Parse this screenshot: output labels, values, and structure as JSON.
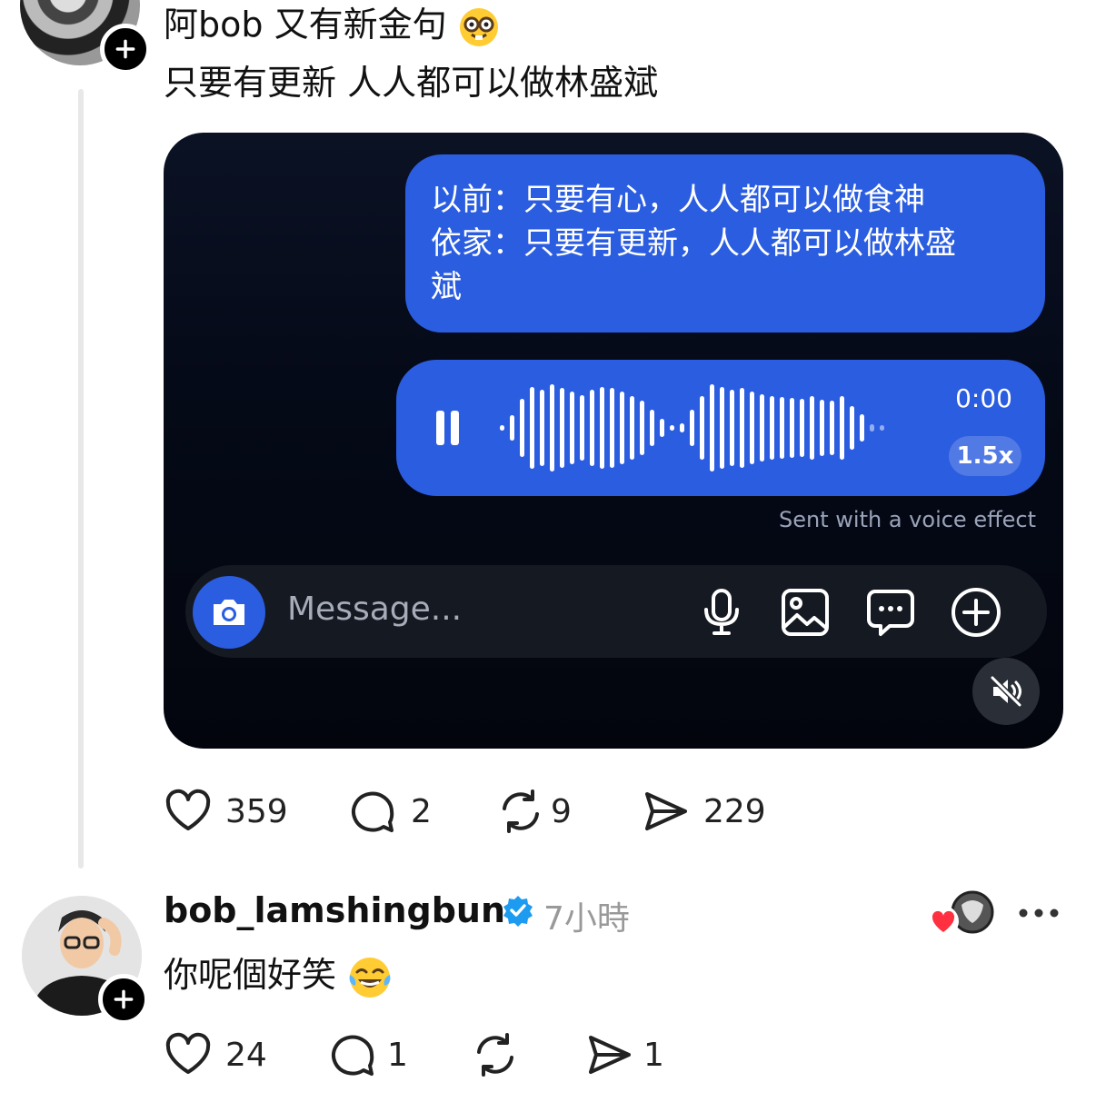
{
  "post": {
    "title": "阿bob 又有新金句",
    "title_emoji": "nerd-face-emoji",
    "body": "只要有更新 人人都可以做林盛斌",
    "media": {
      "message_lines": [
        "以前：只要有心，人人都可以做食神",
        "依家：只要有更新，人人都可以做林盛",
        "斌"
      ],
      "voice_time": "0:00",
      "voice_speed": "1.5x",
      "voice_caption": "Sent with a voice effect",
      "composer_placeholder": "Message..."
    },
    "actions": {
      "likes": "359",
      "comments": "2",
      "reposts": "9",
      "shares": "229"
    }
  },
  "reply": {
    "username": "bob_lamshingbun",
    "time": "7小時",
    "body": "你呢個好笑",
    "body_emoji": "laughing-tears-emoji",
    "actions": {
      "likes": "24",
      "comments": "1",
      "reposts": "",
      "shares": "1"
    }
  },
  "colors": {
    "bubble": "#2b5de0",
    "verified": "#1d9bf0",
    "heart": "#ff3040"
  }
}
